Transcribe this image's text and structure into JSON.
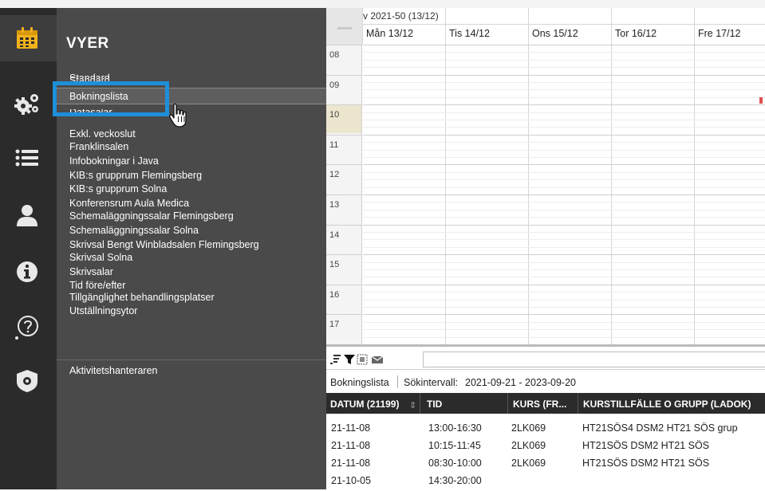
{
  "rail": {
    "icons": [
      "calendar-icon",
      "gears-icon",
      "list-icon",
      "user-icon",
      "info-icon",
      "help-icon",
      "shield-gear-icon"
    ]
  },
  "views": {
    "title": "VYER",
    "items": [
      "Standard",
      "Bokningslista",
      "Datasalar",
      "Exkl. veckoslut",
      "Franklinsalen",
      "Infobokningar i Java",
      "KIB:s grupprum Flemingsberg",
      "KIB:s grupprum Solna",
      "Konferensrum Aula Medica",
      "Schemaläggningssalar Flemingsberg",
      "Schemaläggningssalar Solna",
      "Skrivsal Bengt Winbladsalen Flemingsberg",
      "Skrivsal Solna",
      "Skrivsalar",
      "Tid före/efter",
      "Tillgänglighet behandlingsplatser",
      "Utställningsytor",
      "Aktivitetshanteraren"
    ],
    "selected": "Bokningslista"
  },
  "calendar": {
    "week": "v 2021-50 (13/12)",
    "days": [
      "Mån 13/12",
      "Tis 14/12",
      "Ons 15/12",
      "Tor 16/12",
      "Fre 17/12"
    ],
    "hours": [
      "08",
      "09",
      "10",
      "11",
      "12",
      "13",
      "14",
      "15",
      "16",
      "17"
    ],
    "highlighted_hour": "10"
  },
  "booking_list": {
    "label": "Bokningslista",
    "interval_label": "Sökintervall:",
    "interval_value": "2021-09-21 - 2023-09-20",
    "columns": [
      "DATUM (21199)",
      "TID",
      "KURS (FR...",
      "KURSTILLFÄLLE O GRUPP (LADOK)"
    ],
    "rows": [
      {
        "date": "21-11-08",
        "time": "13:00-16:30",
        "course": "2LK069",
        "group": "HT21SÖS4 DSM2 HT21 SÖS grup"
      },
      {
        "date": "21-11-08",
        "time": "10:15-11:45",
        "course": "2LK069",
        "group": "HT21SÖS DSM2 HT21 SÖS"
      },
      {
        "date": "21-11-08",
        "time": "08:30-10:00",
        "course": "2LK069",
        "group": "HT21SÖS DSM2 HT21 SÖS"
      },
      {
        "date": "21-10-05",
        "time": "14:30-20:00",
        "course": "",
        "group": ""
      }
    ]
  },
  "colors": {
    "rail_bg": "#2b2b2b",
    "panel_bg": "#4a4a4a",
    "icon_gold": "#f2b21c",
    "highlight_blue": "#1e8fd9"
  }
}
